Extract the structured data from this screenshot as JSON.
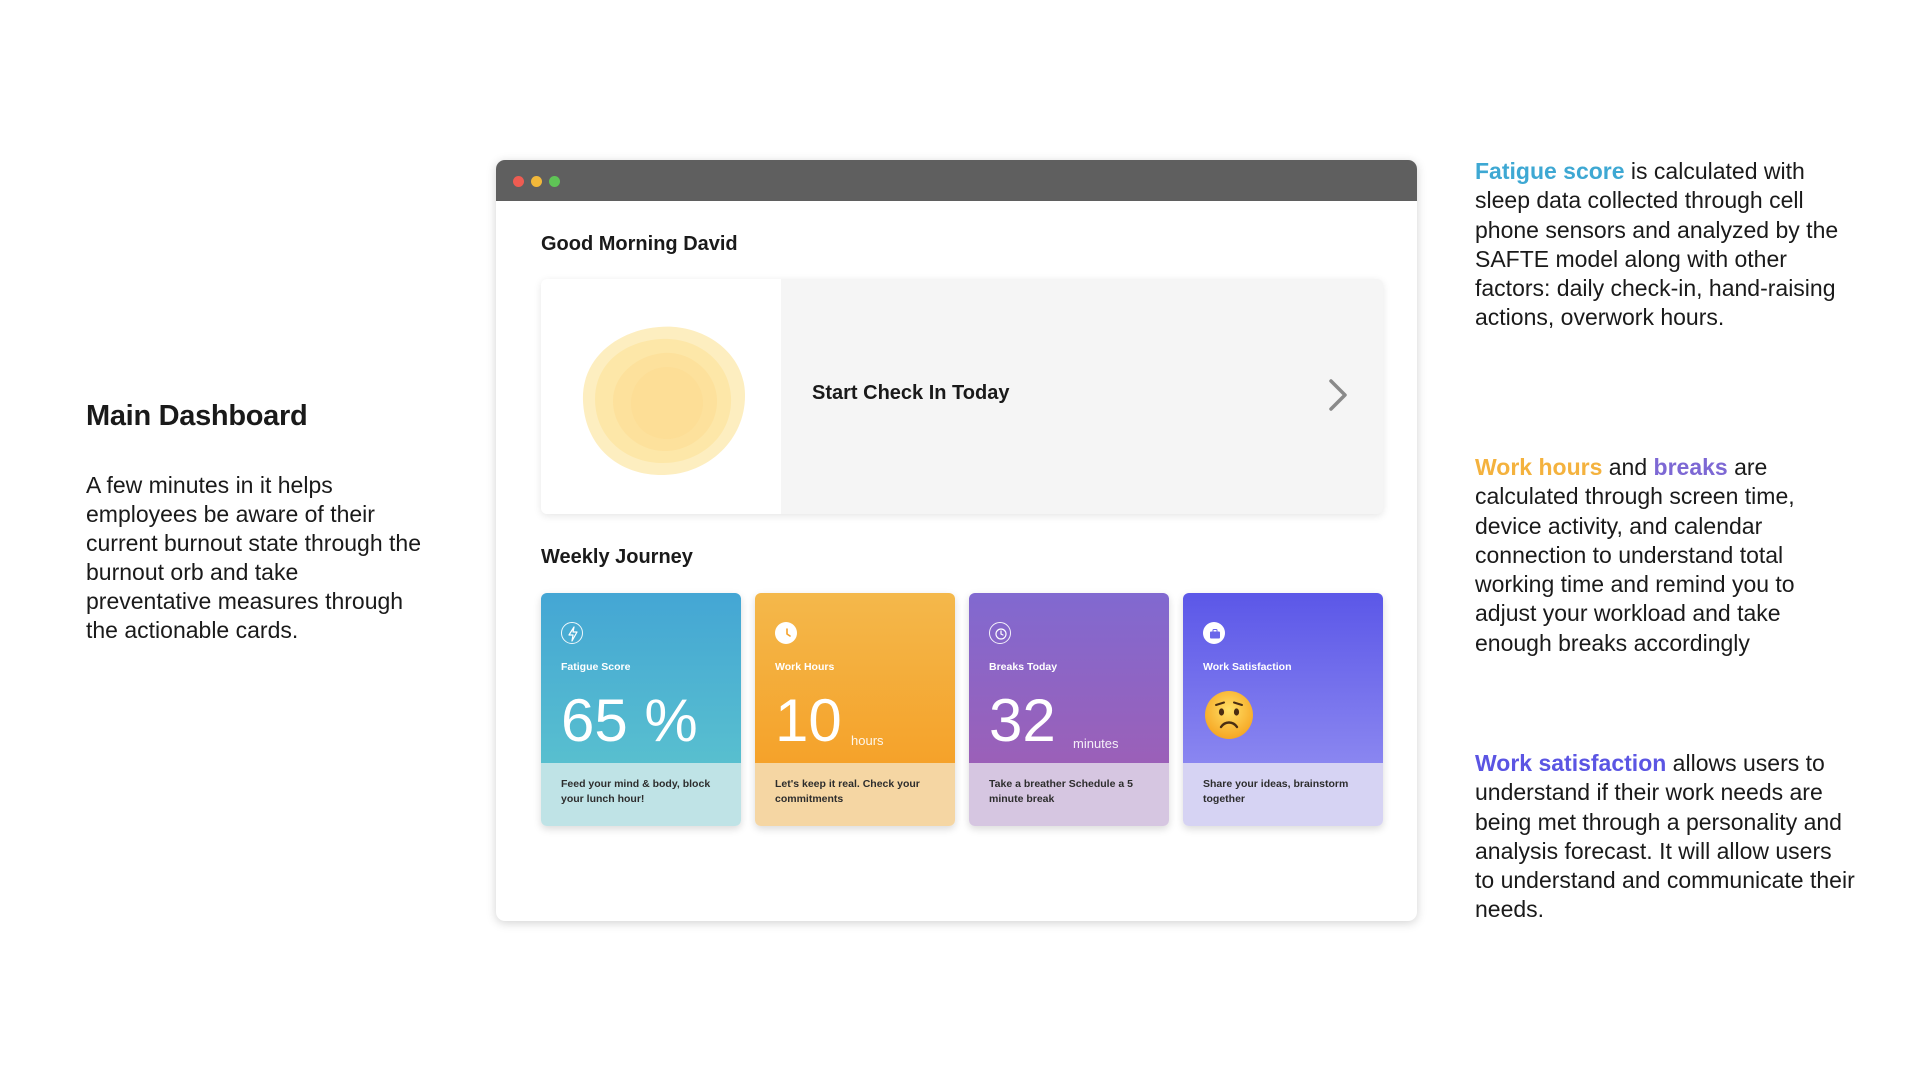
{
  "left": {
    "title": "Main Dashboard",
    "description": "A few minutes in it helps employees be aware of their current burnout state through the burnout orb and take preventative measures through the actionable cards."
  },
  "window": {
    "greeting": "Good Morning David",
    "checkin_label": "Start Check In Today",
    "weekly_title": "Weekly Journey",
    "cards": [
      {
        "label": "Fatigue Score",
        "value": "65 %",
        "unit": "",
        "tip": "Feed your mind & body, block your lunch hour!",
        "icon": "lightning-icon"
      },
      {
        "label": "Work Hours",
        "value": "10",
        "unit": "hours",
        "tip": "Let's keep it real. Check your commitments",
        "icon": "clock-icon"
      },
      {
        "label": "Breaks Today",
        "value": "32",
        "unit": "minutes",
        "tip": "Take a breather Schedule a 5 minute break",
        "icon": "timer-icon"
      },
      {
        "label": "Work Satisfaction",
        "value": "",
        "unit": "",
        "tip": "Share your ideas, brainstorm together",
        "icon": "briefcase-icon",
        "emoji": "worried-face-icon"
      }
    ]
  },
  "notes": {
    "n1": {
      "highlight": "Fatigue score",
      "text": " is calculated with sleep data collected through cell phone sensors and analyzed by the SAFTE model along with other factors: daily check-in, hand-raising actions, overwork hours."
    },
    "n2": {
      "highlight1": "Work hours",
      "mid": " and ",
      "highlight2": "breaks",
      "text": " are calculated through screen time, device activity, and calendar connection to understand total working time and remind you to adjust your workload and take enough breaks accordingly"
    },
    "n3": {
      "highlight": "Work satisfaction",
      "text": " allows users to understand if their work needs are being met through a personality and analysis forecast. It will allow users to understand and communicate their needs."
    }
  },
  "colors": {
    "fatigue": "#3ea8d3",
    "work_hours": "#f4b23e",
    "breaks": "#7d68d4",
    "satisfaction": "#5b55e3"
  }
}
